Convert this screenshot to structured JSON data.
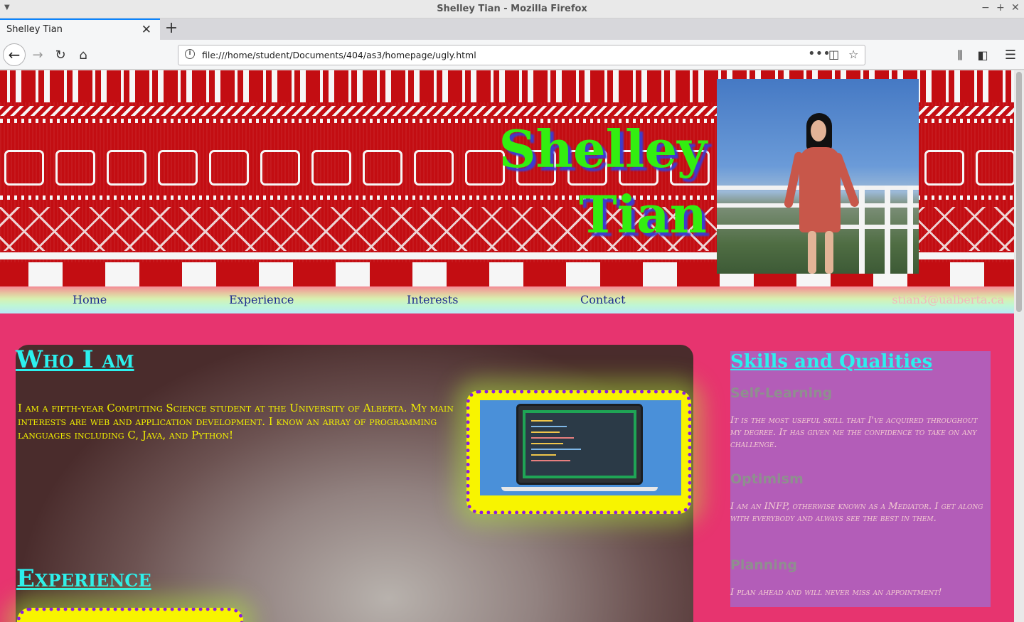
{
  "window": {
    "title": "Shelley Tian - Mozilla Firefox",
    "tab_label": "Shelley Tian",
    "url": "file:///home/student/Documents/404/as3/homepage/ugly.html"
  },
  "page": {
    "header": {
      "name_line1": "Shelley",
      "name_line2": "Tian"
    },
    "nav": {
      "home": "Home",
      "experience": "Experience",
      "interests": "Interests",
      "contact": "Contact",
      "email": "stian3@ualberta.ca"
    },
    "who": {
      "heading": "Who I am",
      "text": "I am a fifth-year Computing Science student at the University of Alberta. My main interests are web and application development. I know an array of programming languages including C, Java, and Python!"
    },
    "experience": {
      "heading": "Experience"
    },
    "skills": {
      "heading": "Skills and Qualities",
      "items": [
        {
          "title": "Self-Learning",
          "text": "It is the most useful skill that I've acquired throughout my degree. It has given me the confidence to take on any challenge."
        },
        {
          "title": "Optimism",
          "text": "I am an INFP, otherwise known as a Mediator. I get along with everybody and always see the best in them."
        },
        {
          "title": "Planning",
          "text": "I plan ahead and will never miss an appointment!"
        }
      ]
    }
  },
  "colors": {
    "page_bg": "#e7346f",
    "heading_cyan": "#2cf0ee",
    "name_green": "#33ee10",
    "intro_yellow": "#f1f000",
    "frame_yellow": "#f8f400",
    "frame_dots": "#8a1de0",
    "skills_bg": "#b35db8"
  },
  "icons": [
    "menu-arrow-icon",
    "minimize-icon",
    "maximize-icon",
    "close-window-icon",
    "tab-close-icon",
    "new-tab-icon",
    "back-icon",
    "forward-icon",
    "reload-icon",
    "home-icon",
    "site-info-icon",
    "page-actions-icon",
    "pocket-icon",
    "bookmark-star-icon",
    "library-icon",
    "sidebar-icon",
    "hamburger-menu-icon"
  ]
}
